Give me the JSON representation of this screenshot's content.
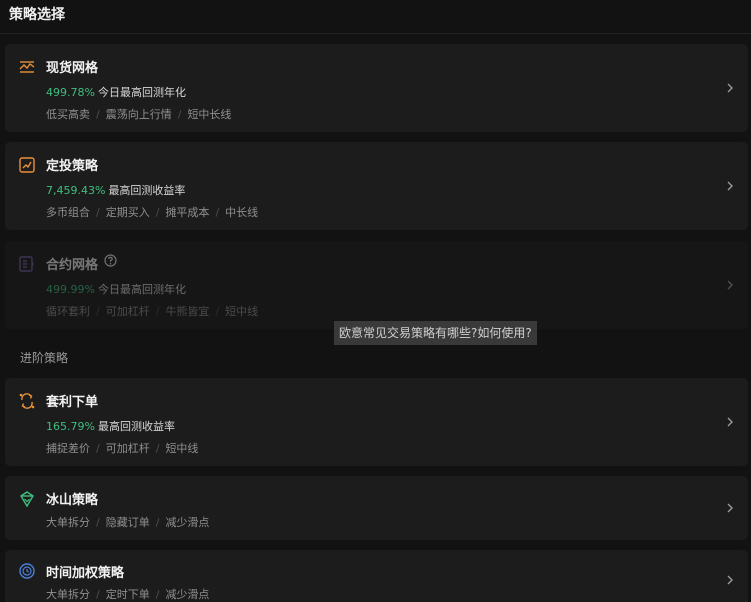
{
  "header": {
    "title": "策略选择"
  },
  "basic_strategies": [
    {
      "icon": "grid-wave-icon",
      "title": "现货网格",
      "pct": "499.78%",
      "stat_label": "今日最高回测年化",
      "tags": [
        "低买高卖",
        "震荡向上行情",
        "短中长线"
      ],
      "disabled": false
    },
    {
      "icon": "chart-trend-icon",
      "title": "定投策略",
      "pct": "7,459.43%",
      "stat_label": "最高回测收益率",
      "tags": [
        "多币组合",
        "定期买入",
        "摊平成本",
        "中长线"
      ],
      "disabled": false
    },
    {
      "icon": "contract-doc-icon",
      "title": "合约网格",
      "pct": "499.99%",
      "stat_label": "今日最高回测年化",
      "tags": [
        "循环套利",
        "可加杠杆",
        "牛熊皆宜",
        "短中线"
      ],
      "disabled": true,
      "help_icon": "question-circle-icon"
    }
  ],
  "advanced_section": {
    "title": "进阶策略"
  },
  "advanced_strategies": [
    {
      "icon": "arbitrage-arrows-icon",
      "title": "套利下单",
      "pct": "165.79%",
      "stat_label": "最高回测收益率",
      "tags": [
        "捕捉差价",
        "可加杠杆",
        "短中线"
      ]
    },
    {
      "icon": "iceberg-icon",
      "title": "冰山策略",
      "tags": [
        "大单拆分",
        "隐藏订单",
        "减少滑点"
      ]
    },
    {
      "icon": "coin-clock-icon",
      "title": "时间加权策略",
      "tags": [
        "大单拆分",
        "定时下单",
        "减少滑点"
      ]
    }
  ],
  "watermark": {
    "text": "欧意常见交易策略有哪些?如何使用?"
  },
  "colors": {
    "accent_orange": "#e8923a",
    "positive_green": "#3fbf7f",
    "disabled_purple": "#7a5ca8"
  }
}
